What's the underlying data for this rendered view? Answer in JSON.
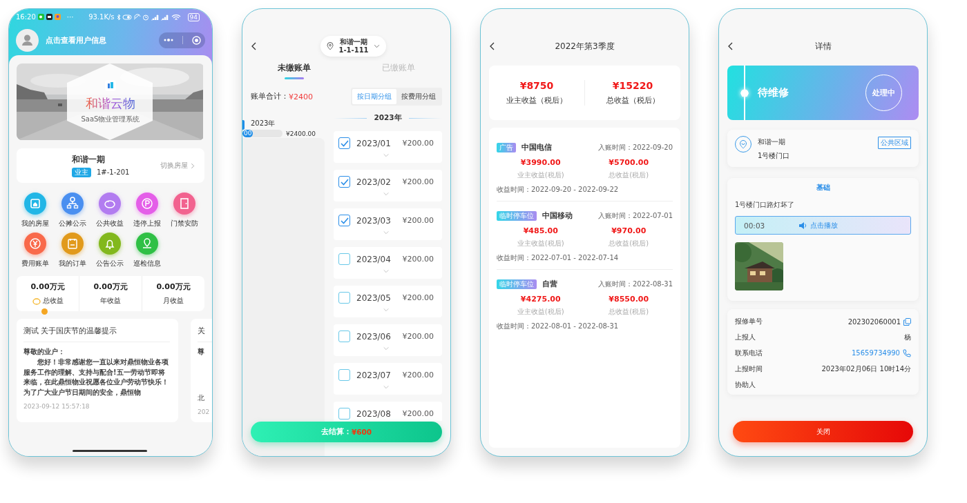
{
  "home": {
    "status_bar": {
      "time": "16:20",
      "more": "···",
      "speed": "93.1K/s",
      "battery": "94"
    },
    "user_prompt": "点击查看用户信息",
    "banner": {
      "title": "和谐云物",
      "subtitle": "SaaS物业管理系统"
    },
    "house": {
      "name": "和谐一期",
      "role": "业主",
      "unit": "1#-1-201",
      "switch": "切换房屋"
    },
    "menu": [
      {
        "label": "我的房屋",
        "color": "#21b6e6"
      },
      {
        "label": "公摊公示",
        "color": "#4a8ff0"
      },
      {
        "label": "公共收益",
        "color": "#b27cf0"
      },
      {
        "label": "违停上报",
        "color": "#e45ee8"
      },
      {
        "label": "门禁安防",
        "color": "#f2628f"
      },
      {
        "label": "费用账单",
        "color": "#f9694a"
      },
      {
        "label": "我的订单",
        "color": "#e19a1c"
      },
      {
        "label": "公告公示",
        "color": "#82b81c"
      },
      {
        "label": "巡检信息",
        "color": "#2fc045"
      }
    ],
    "stats": [
      {
        "value": "0.00万元",
        "label": "总收益"
      },
      {
        "value": "0.00万元",
        "label": "年收益"
      },
      {
        "value": "0.00万元",
        "label": "月收益"
      }
    ],
    "notices": [
      {
        "title": "测试 关于国庆节的温馨提示",
        "greeting": "尊敬的业户：",
        "body": "您好！非常感谢您一直以来对鼎恒物业各项服务工作的理解、支持与配合!五一劳动节即将来临，在此鼎恒物业祝愿各位业户劳动节快乐！为了广大业户节日期间的安全，鼎恒物",
        "time": "2023-09-12 15:57:18"
      },
      {
        "title": "关",
        "greeting": "尊",
        "signature": "北",
        "time": "202"
      }
    ]
  },
  "bills": {
    "location": {
      "name": "和谐一期",
      "unit": "1-1-111"
    },
    "tabs": [
      {
        "label": "未缴账单",
        "selected": true
      },
      {
        "label": "已缴账单",
        "selected": false
      }
    ],
    "total_label": "账单合计：",
    "total": "¥2400",
    "groupings": [
      {
        "label": "按日期分组",
        "selected": true
      },
      {
        "label": "按费用分组",
        "selected": false
      }
    ],
    "years": [
      {
        "label": "2023年",
        "selected": true,
        "progress": "00",
        "level": 0.25,
        "amount": "¥2400.00"
      }
    ],
    "section": "2023年",
    "items": [
      {
        "month": "2023/01",
        "amount": "¥200.00",
        "checked": true
      },
      {
        "month": "2023/02",
        "amount": "¥200.00",
        "checked": true
      },
      {
        "month": "2023/03",
        "amount": "¥200.00",
        "checked": true
      },
      {
        "month": "2023/04",
        "amount": "¥200.00",
        "checked": false
      },
      {
        "month": "2023/05",
        "amount": "¥200.00",
        "checked": false
      },
      {
        "month": "2023/06",
        "amount": "¥200.00",
        "checked": false
      },
      {
        "month": "2023/07",
        "amount": "¥200.00",
        "checked": false
      },
      {
        "month": "2023/08",
        "amount": "¥200.00",
        "checked": false
      }
    ],
    "checkout": {
      "label": "去结算：",
      "amount": "¥600"
    }
  },
  "income": {
    "title": "2022年第3季度",
    "summary": [
      {
        "amount": "¥8750",
        "label": "业主收益（税后）"
      },
      {
        "amount": "¥15220",
        "label": "总收益（税后）"
      }
    ],
    "records": [
      {
        "tag": "广告",
        "name": "中国电信",
        "posted": "入账时间：2022-09-20",
        "owner_amount": "¥3990.00",
        "owner_label": "业主收益(税后)",
        "total_amount": "¥5700.00",
        "total_label": "总收益(税后)",
        "period": "收益时间：2022-09-20 - 2022-09-22"
      },
      {
        "tag": "临时停车位",
        "name": "中国移动",
        "posted": "入账时间：2022-07-01",
        "owner_amount": "¥485.00",
        "owner_label": "业主收益(税后)",
        "total_amount": "¥970.00",
        "total_label": "总收益(税后)",
        "period": "收益时间：2022-07-01 - 2022-07-14"
      },
      {
        "tag": "临时停车位",
        "name": "自营",
        "posted": "入账时间：2022-08-31",
        "owner_amount": "¥4275.00",
        "owner_label": "业主收益(税后)",
        "total_amount": "¥8550.00",
        "total_label": "总收益(税后)",
        "period": "收益时间：2022-08-01 - 2022-08-31"
      }
    ]
  },
  "detail": {
    "title": "详情",
    "status": {
      "label": "待维修",
      "badge": "处理中"
    },
    "location": {
      "project": "和谐一期",
      "place": "1号楼门口",
      "area": "公共区域"
    },
    "category": "基础",
    "description": "1号楼门口路灯坏了",
    "audio": {
      "duration": "00:03",
      "action": "点击播放"
    },
    "fields": [
      {
        "label": "报修单号",
        "value": "202302060001",
        "kind": "copy"
      },
      {
        "label": "上报人",
        "value": "杨",
        "kind": "text"
      },
      {
        "label": "联系电话",
        "value": "15659734990",
        "kind": "phone"
      },
      {
        "label": "上报时间",
        "value": "2023年02月06日 10时14分",
        "kind": "text"
      },
      {
        "label": "协助人",
        "kind": "text"
      }
    ],
    "close": "关闭"
  }
}
